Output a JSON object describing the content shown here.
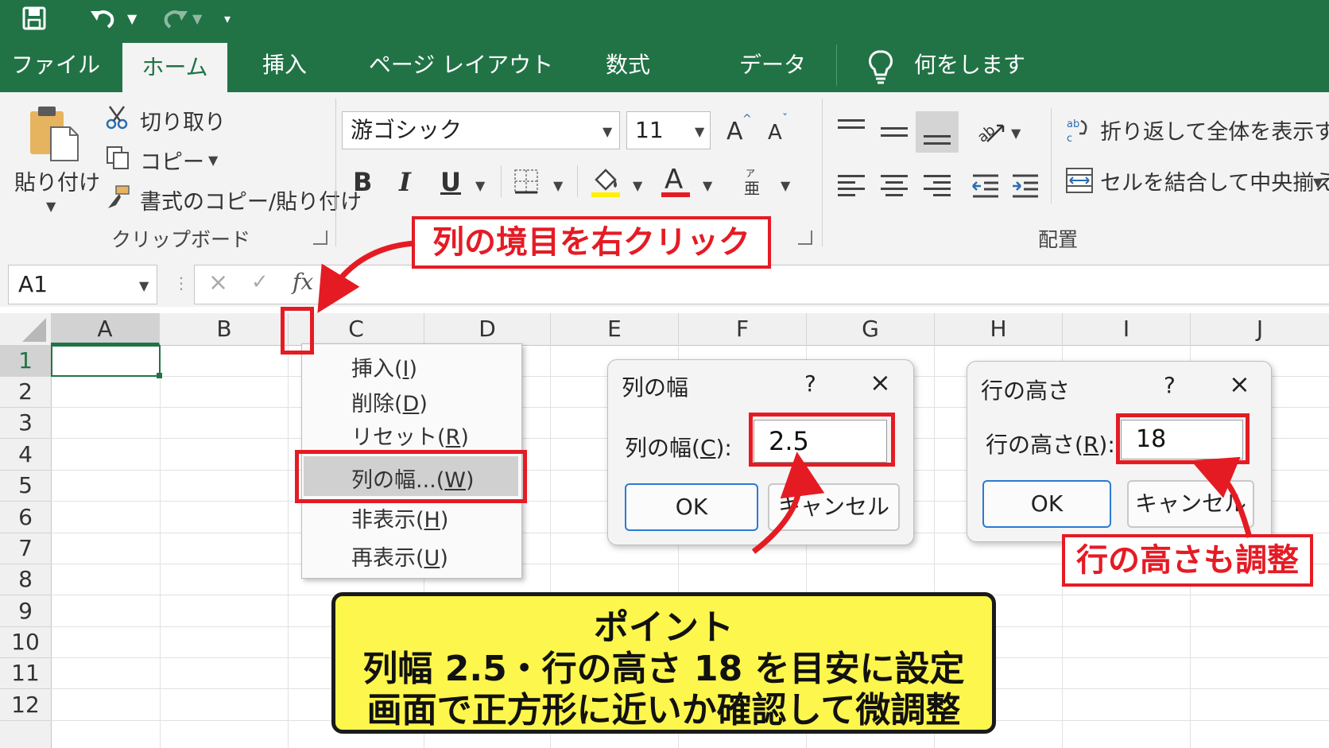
{
  "quick_access": {
    "save_icon": "save-icon",
    "undo_icon": "undo-icon",
    "redo_icon": "redo-icon",
    "customize_icon": "customize-icon"
  },
  "tabs": [
    {
      "label": "ファイル"
    },
    {
      "label": "ホーム"
    },
    {
      "label": "挿入"
    },
    {
      "label": "ページ レイアウト"
    },
    {
      "label": "数式"
    },
    {
      "label": "データ"
    }
  ],
  "tell_me": {
    "label": "何をしますか"
  },
  "clipboard": {
    "paste": "貼り付け",
    "cut": "切り取り",
    "copy": "コピー",
    "format_painter": "書式のコピー/貼り付け",
    "group": "クリップボード"
  },
  "font": {
    "name": "游ゴシック",
    "size": "11",
    "grow": "A",
    "shrink": "A",
    "bold": "B",
    "italic": "I",
    "underline": "U",
    "fill": "◇",
    "color": "A"
  },
  "alignment": {
    "wrap": "折り返して全体を表示する",
    "merge": "セルを結合して中央揃え",
    "group": "配置"
  },
  "formula_bar": {
    "name_box": "A1",
    "cancel": "×",
    "enter": "✓",
    "fx": "fx"
  },
  "columns": [
    "A",
    "B",
    "C",
    "D",
    "E",
    "F",
    "G",
    "H",
    "I",
    "J"
  ],
  "rows": [
    "1",
    "2",
    "3",
    "4",
    "5",
    "6",
    "7",
    "8",
    "9",
    "10",
    "11",
    "12"
  ],
  "context_menu": [
    {
      "label": "挿入(",
      "key": "I",
      "end": ")"
    },
    {
      "label": "削除(",
      "key": "D",
      "end": ")"
    },
    {
      "label": "リセット(",
      "key": "R",
      "end": ")"
    },
    {
      "label": "列の幅...(",
      "key": "W",
      "end": ")"
    },
    {
      "label": "非表示(",
      "key": "H",
      "end": ")"
    },
    {
      "label": "再表示(",
      "key": "U",
      "end": ")"
    }
  ],
  "col_width_dialog": {
    "title": "列の幅",
    "help": "?",
    "close": "×",
    "label_pre": "列の幅(",
    "label_key": "C",
    "label_post": "):",
    "value": "2.5",
    "ok": "OK",
    "cancel": "キャンセル"
  },
  "row_height_dialog": {
    "title": "行の高さ",
    "help": "?",
    "close": "×",
    "label_pre": "行の高さ(",
    "label_key": "R",
    "label_post": "):",
    "value": "18",
    "ok": "OK",
    "cancel": "キャンセル"
  },
  "callouts": {
    "right_click": "列の境目を右クリック",
    "row_height": "行の高さも調整"
  },
  "point": {
    "line1": "ポイント",
    "line2": "列幅 2.5・行の高さ 18 を目安に設定",
    "line3": "画面で正方形に近いか確認して微調整"
  },
  "colors": {
    "excel_green": "#217346",
    "annotation_red": "#e51b24",
    "note_yellow": "#fdf64c"
  }
}
